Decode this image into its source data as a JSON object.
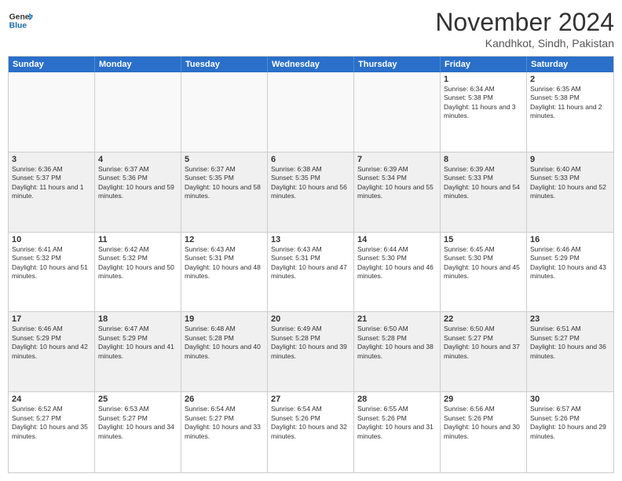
{
  "header": {
    "logo_line1": "General",
    "logo_line2": "Blue",
    "month_title": "November 2024",
    "location": "Kandhkot, Sindh, Pakistan"
  },
  "weekdays": [
    "Sunday",
    "Monday",
    "Tuesday",
    "Wednesday",
    "Thursday",
    "Friday",
    "Saturday"
  ],
  "weeks": [
    [
      {
        "day": "",
        "info": ""
      },
      {
        "day": "",
        "info": ""
      },
      {
        "day": "",
        "info": ""
      },
      {
        "day": "",
        "info": ""
      },
      {
        "day": "",
        "info": ""
      },
      {
        "day": "1",
        "info": "Sunrise: 6:34 AM\nSunset: 5:38 PM\nDaylight: 11 hours and 3 minutes."
      },
      {
        "day": "2",
        "info": "Sunrise: 6:35 AM\nSunset: 5:38 PM\nDaylight: 11 hours and 2 minutes."
      }
    ],
    [
      {
        "day": "3",
        "info": "Sunrise: 6:36 AM\nSunset: 5:37 PM\nDaylight: 11 hours and 1 minute."
      },
      {
        "day": "4",
        "info": "Sunrise: 6:37 AM\nSunset: 5:36 PM\nDaylight: 10 hours and 59 minutes."
      },
      {
        "day": "5",
        "info": "Sunrise: 6:37 AM\nSunset: 5:35 PM\nDaylight: 10 hours and 58 minutes."
      },
      {
        "day": "6",
        "info": "Sunrise: 6:38 AM\nSunset: 5:35 PM\nDaylight: 10 hours and 56 minutes."
      },
      {
        "day": "7",
        "info": "Sunrise: 6:39 AM\nSunset: 5:34 PM\nDaylight: 10 hours and 55 minutes."
      },
      {
        "day": "8",
        "info": "Sunrise: 6:39 AM\nSunset: 5:33 PM\nDaylight: 10 hours and 54 minutes."
      },
      {
        "day": "9",
        "info": "Sunrise: 6:40 AM\nSunset: 5:33 PM\nDaylight: 10 hours and 52 minutes."
      }
    ],
    [
      {
        "day": "10",
        "info": "Sunrise: 6:41 AM\nSunset: 5:32 PM\nDaylight: 10 hours and 51 minutes."
      },
      {
        "day": "11",
        "info": "Sunrise: 6:42 AM\nSunset: 5:32 PM\nDaylight: 10 hours and 50 minutes."
      },
      {
        "day": "12",
        "info": "Sunrise: 6:43 AM\nSunset: 5:31 PM\nDaylight: 10 hours and 48 minutes."
      },
      {
        "day": "13",
        "info": "Sunrise: 6:43 AM\nSunset: 5:31 PM\nDaylight: 10 hours and 47 minutes."
      },
      {
        "day": "14",
        "info": "Sunrise: 6:44 AM\nSunset: 5:30 PM\nDaylight: 10 hours and 46 minutes."
      },
      {
        "day": "15",
        "info": "Sunrise: 6:45 AM\nSunset: 5:30 PM\nDaylight: 10 hours and 45 minutes."
      },
      {
        "day": "16",
        "info": "Sunrise: 6:46 AM\nSunset: 5:29 PM\nDaylight: 10 hours and 43 minutes."
      }
    ],
    [
      {
        "day": "17",
        "info": "Sunrise: 6:46 AM\nSunset: 5:29 PM\nDaylight: 10 hours and 42 minutes."
      },
      {
        "day": "18",
        "info": "Sunrise: 6:47 AM\nSunset: 5:29 PM\nDaylight: 10 hours and 41 minutes."
      },
      {
        "day": "19",
        "info": "Sunrise: 6:48 AM\nSunset: 5:28 PM\nDaylight: 10 hours and 40 minutes."
      },
      {
        "day": "20",
        "info": "Sunrise: 6:49 AM\nSunset: 5:28 PM\nDaylight: 10 hours and 39 minutes."
      },
      {
        "day": "21",
        "info": "Sunrise: 6:50 AM\nSunset: 5:28 PM\nDaylight: 10 hours and 38 minutes."
      },
      {
        "day": "22",
        "info": "Sunrise: 6:50 AM\nSunset: 5:27 PM\nDaylight: 10 hours and 37 minutes."
      },
      {
        "day": "23",
        "info": "Sunrise: 6:51 AM\nSunset: 5:27 PM\nDaylight: 10 hours and 36 minutes."
      }
    ],
    [
      {
        "day": "24",
        "info": "Sunrise: 6:52 AM\nSunset: 5:27 PM\nDaylight: 10 hours and 35 minutes."
      },
      {
        "day": "25",
        "info": "Sunrise: 6:53 AM\nSunset: 5:27 PM\nDaylight: 10 hours and 34 minutes."
      },
      {
        "day": "26",
        "info": "Sunrise: 6:54 AM\nSunset: 5:27 PM\nDaylight: 10 hours and 33 minutes."
      },
      {
        "day": "27",
        "info": "Sunrise: 6:54 AM\nSunset: 5:26 PM\nDaylight: 10 hours and 32 minutes."
      },
      {
        "day": "28",
        "info": "Sunrise: 6:55 AM\nSunset: 5:26 PM\nDaylight: 10 hours and 31 minutes."
      },
      {
        "day": "29",
        "info": "Sunrise: 6:56 AM\nSunset: 5:26 PM\nDaylight: 10 hours and 30 minutes."
      },
      {
        "day": "30",
        "info": "Sunrise: 6:57 AM\nSunset: 5:26 PM\nDaylight: 10 hours and 29 minutes."
      }
    ]
  ]
}
